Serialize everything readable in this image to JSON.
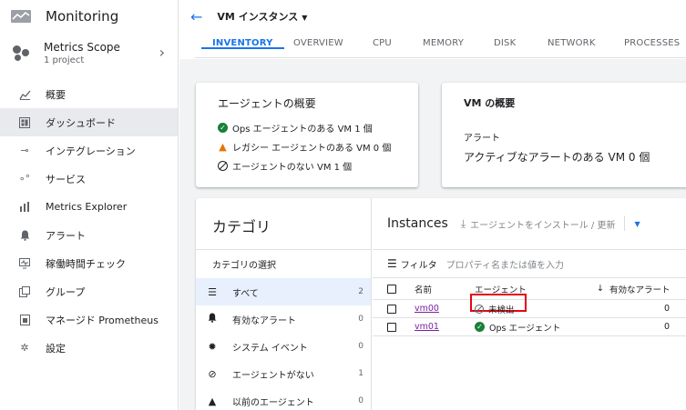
{
  "app": {
    "title": "Monitoring"
  },
  "scope": {
    "title": "Metrics Scope",
    "subtitle": "1 project"
  },
  "nav": [
    {
      "label": "概要",
      "icon": "chart-icon"
    },
    {
      "label": "ダッシュボード",
      "icon": "dashboard-icon",
      "active": true
    },
    {
      "label": "インテグレーション",
      "icon": "integration-icon"
    },
    {
      "label": "サービス",
      "icon": "services-icon"
    },
    {
      "label": "Metrics Explorer",
      "icon": "bar-chart-icon"
    },
    {
      "label": "アラート",
      "icon": "bell-icon"
    },
    {
      "label": "稼働時間チェック",
      "icon": "monitor-icon"
    },
    {
      "label": "グループ",
      "icon": "group-icon"
    },
    {
      "label": "マネージド Prometheus",
      "icon": "prometheus-icon"
    },
    {
      "label": "設定",
      "icon": "gear-icon"
    }
  ],
  "topbar": {
    "vm_select": "VM インスタンス"
  },
  "tabs": [
    "INVENTORY",
    "OVERVIEW",
    "CPU",
    "MEMORY",
    "DISK",
    "NETWORK",
    "PROCESSES"
  ],
  "agent_card": {
    "title": "エージェントの概要",
    "ops": "Ops エージェントのある VM 1 個",
    "legacy": "レガシー エージェントのある VM 0 個",
    "none": "エージェントのない VM 1 個"
  },
  "vm_card": {
    "title": "VM の概要",
    "alert_label": "アラート",
    "alert_text": "アクティブなアラートのある VM 0 個"
  },
  "categories": {
    "title": "カテゴリ",
    "subtitle": "カテゴリの選択",
    "items": [
      {
        "label": "すべて",
        "count": "2"
      },
      {
        "label": "有効なアラート",
        "count": "0"
      },
      {
        "label": "システム イベント",
        "count": "0"
      },
      {
        "label": "エージェントがない",
        "count": "1"
      },
      {
        "label": "以前のエージェント",
        "count": "0"
      }
    ]
  },
  "instances": {
    "title": "Instances",
    "install_label": "エージェントをインストール / 更新",
    "filter_label": "フィルタ",
    "filter_placeholder": "プロパティ名または値を入力",
    "columns": {
      "name": "名前",
      "agent": "エージェント",
      "alerts": "有効なアラート"
    },
    "rows": [
      {
        "name": "vm00",
        "agent": "未検出",
        "alerts": "0"
      },
      {
        "name": "vm01",
        "agent": "Ops エージェント",
        "alerts": "0"
      }
    ]
  }
}
